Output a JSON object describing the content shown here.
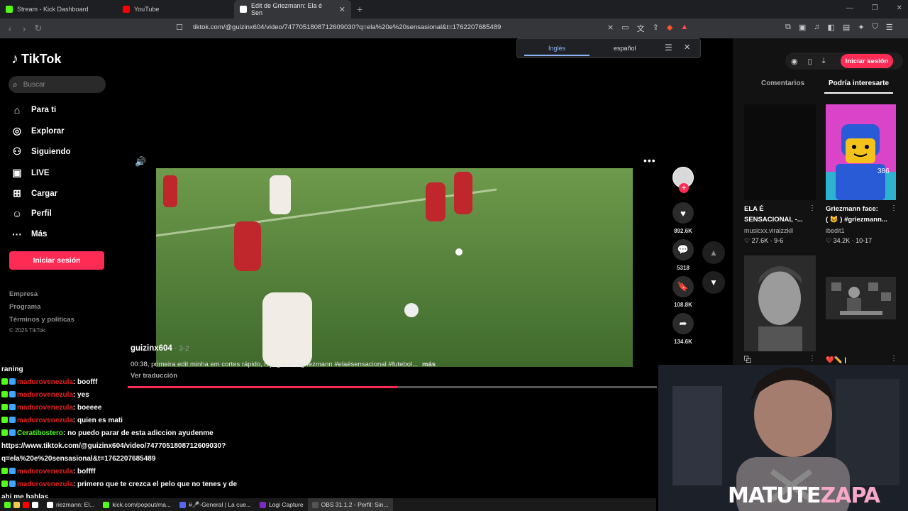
{
  "browser": {
    "tabs": [
      {
        "title": "Stream - Kick Dashboard",
        "icon": "kick-icon",
        "color": "#53fc18"
      },
      {
        "title": "YouTube",
        "icon": "youtube-icon",
        "color": "#ff0000"
      },
      {
        "title": "Edit de Griezmann: Ela é Sen",
        "icon": "tiktok-icon",
        "color": "#ffffff",
        "active": true
      }
    ],
    "url": "tiktok.com/@guizinx604/video/7477051808712609030?q=ela%20e%20sensasional&t=1762207685489"
  },
  "translate_popup": {
    "source": "Inglés",
    "target": "español"
  },
  "sidebar": {
    "logo": "TikTok",
    "search_placeholder": "Buscar",
    "nav": [
      {
        "label": "Para ti",
        "icon": "home-icon"
      },
      {
        "label": "Explorar",
        "icon": "compass-icon"
      },
      {
        "label": "Siguiendo",
        "icon": "following-icon"
      },
      {
        "label": "LIVE",
        "icon": "live-icon"
      },
      {
        "label": "Cargar",
        "icon": "upload-icon"
      },
      {
        "label": "Perfil",
        "icon": "profile-icon"
      },
      {
        "label": "Más",
        "icon": "more-icon"
      }
    ],
    "signin": "Iniciar sesión",
    "footer_links": [
      "Empresa",
      "Programa",
      "Términos y políticas"
    ],
    "copyright": "© 2025 TikTok"
  },
  "video": {
    "author": "guizinx604",
    "date": "3-2",
    "timestamp": "00:38",
    "caption": "primeira edit minha em cortes rápido, n julguem, #griezmann #elaésensacional #futebol...",
    "more": "más",
    "see_translation": "Ver traducción",
    "progress_percent": 51
  },
  "actions": {
    "likes": "892.6K",
    "comments": "5318",
    "saves": "108.8K",
    "shares": "134.6K"
  },
  "right_panel": {
    "signin": "Iniciar sesión",
    "tabs": [
      "Comentarios",
      "Podría interesarte"
    ],
    "videos": [
      {
        "title1": "ELA É",
        "title2": "SENSACIONAL -...",
        "author": "musicxx.viralzzkll",
        "likes": "27.6K",
        "date": "9-6"
      },
      {
        "title1": "Griezmann face:",
        "title2": "( 😺 ) #griezmann...",
        "author": "ibedit1",
        "likes": "34.2K",
        "date": "10-17",
        "overlay": "386"
      }
    ],
    "partial_titles": [
      "⿻",
      "❤️✏️ |"
    ]
  },
  "chat": [
    {
      "type": "plain",
      "text": "raning"
    },
    {
      "user": "madurovenezula",
      "msg": ": boofff"
    },
    {
      "user": "madurovenezula",
      "msg": ": yes"
    },
    {
      "user": "madurovenezula",
      "msg": ": boeeee"
    },
    {
      "user": "madurovenezula",
      "msg": ": quien es mati"
    },
    {
      "user": "Ceratibostero",
      "msg": ": no puedo parar de esta adiccion ayudenme",
      "green": true
    },
    {
      "type": "plain",
      "text": "https://www.tiktok.com/@guizinx604/video/7477051808712609030?"
    },
    {
      "type": "plain",
      "text": "q=ela%20e%20sensasional&t=1762207685489"
    },
    {
      "user": "madurovenezula",
      "msg": ": boffff"
    },
    {
      "user": "madurovenezula",
      "msg": ": primero que te crezca el pelo que no tenes y de"
    },
    {
      "type": "plain",
      "text": "ahi me hablas"
    }
  ],
  "stream_overlay": {
    "brand_white": "MATUTE",
    "brand_pink": "ZAPA"
  },
  "taskbar": [
    {
      "label": "riezmann: El...",
      "color": "#ffffff"
    },
    {
      "label": "kick.com/popout/ma...",
      "color": "#53fc18"
    },
    {
      "label": "#🎤-General | La cue...",
      "color": "#5865f2"
    },
    {
      "label": "Logi Capture",
      "color": "#7b2cbf"
    },
    {
      "label": "OBS 31.1.2 - Perfil: Sin...",
      "color": "#555555",
      "active": true
    }
  ],
  "colors": {
    "tiktok_red": "#fe2c55",
    "kick_green": "#53fc18",
    "chat_user_red": "#e32222"
  }
}
